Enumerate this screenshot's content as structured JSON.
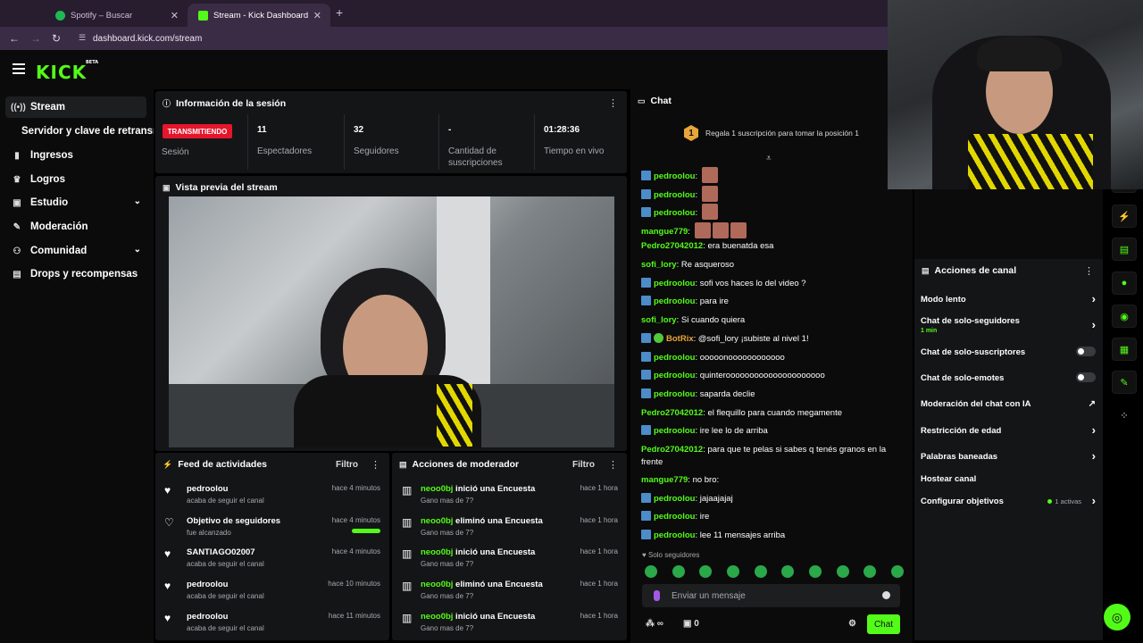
{
  "browser": {
    "tabs": [
      {
        "label": "Spotify – Buscar",
        "color": "#1db954"
      },
      {
        "label": "Stream - Kick Dashboard",
        "color": "#53fc18"
      }
    ],
    "url": "dashboard.kick.com/stream"
  },
  "brand": {
    "logo": "KICK",
    "beta": "BETA",
    "accent": "#53fc18"
  },
  "sidebar": {
    "items": [
      {
        "label": "Stream",
        "icon": "broadcast-icon"
      },
      {
        "label": "Servidor y clave de retransmisión"
      },
      {
        "label": "Ingresos",
        "icon": "chart-icon"
      },
      {
        "label": "Logros",
        "icon": "trophy-icon"
      },
      {
        "label": "Estudio",
        "icon": "studio-icon"
      },
      {
        "label": "Moderación",
        "icon": "wrench-icon"
      },
      {
        "label": "Comunidad",
        "icon": "community-icon"
      },
      {
        "label": "Drops y recompensas",
        "icon": "gift-icon"
      }
    ]
  },
  "session": {
    "title": "Información de la sesión",
    "live_badge": "TRANSMITIENDO",
    "session_label": "Sesión",
    "stats": [
      {
        "value": "11",
        "label": "Espectadores"
      },
      {
        "value": "32",
        "label": "Seguidores"
      },
      {
        "value": "-",
        "label": "Cantidad de suscripciones"
      },
      {
        "value": "01:28:36",
        "label": "Tiempo en vivo"
      }
    ]
  },
  "preview": {
    "title": "Vista previa del stream"
  },
  "feed": {
    "title": "Feed de actividades",
    "filter": "Filtro",
    "items": [
      {
        "name": "pedroolou",
        "sub": "acaba de seguir el canal",
        "time": "hace 4 minutos",
        "icon": "heart-icon"
      },
      {
        "name": "Objetivo de seguidores",
        "sub": "fue alcanzado",
        "time": "hace 4 minutos",
        "icon": "heart-outline-icon",
        "progress": 1.0
      },
      {
        "name": "SANTIAGO02007",
        "sub": "acaba de seguir el canal",
        "time": "hace 4 minutos",
        "icon": "heart-icon"
      },
      {
        "name": "pedroolou",
        "sub": "acaba de seguir el canal",
        "time": "hace 10 minutos",
        "icon": "heart-icon"
      },
      {
        "name": "pedroolou",
        "sub": "acaba de seguir el canal",
        "time": "hace 11 minutos",
        "icon": "heart-icon"
      }
    ]
  },
  "modactions": {
    "title": "Acciones de moderador",
    "filter": "Filtro",
    "items": [
      {
        "user": "neoo0bj",
        "action": " inició una Encuesta",
        "sub": "Gano mas de 7?",
        "time": "hace 1 hora"
      },
      {
        "user": "neoo0bj",
        "action": " eliminó una Encuesta",
        "sub": "Gano mas de 7?",
        "time": "hace 1 hora"
      },
      {
        "user": "neoo0bj",
        "action": " inició una Encuesta",
        "sub": "Gano mas de 7?",
        "time": "hace 1 hora"
      },
      {
        "user": "neoo0bj",
        "action": " eliminó una Encuesta",
        "sub": "Gano mas de 7?",
        "time": "hace 1 hora"
      },
      {
        "user": "neoo0bj",
        "action": " inició una Encuesta",
        "sub": "Gano mas de 7?",
        "time": "hace 1 hora"
      }
    ]
  },
  "chat": {
    "title": "Chat",
    "pinned_rank": "1",
    "pinned_text": "Regala 1 suscripción para tomar la posición 1",
    "messages": [
      {
        "user": "pedroolou",
        "text": "",
        "mod": true,
        "emotes": 1
      },
      {
        "user": "pedroolou",
        "text": "",
        "mod": true,
        "emotes": 1
      },
      {
        "user": "pedroolou",
        "text": "",
        "mod": true,
        "emotes": 1
      },
      {
        "user": "mangue779",
        "text": "",
        "mod": false,
        "emotes": 3
      },
      {
        "user": "Pedro27042012",
        "text": "era buenatda esa",
        "mod": false
      },
      {
        "user": "sofi_lory",
        "text": "Re asqueroso",
        "mod": false
      },
      {
        "user": "pedroolou",
        "text": "sofi vos haces lo del video ?",
        "mod": true
      },
      {
        "user": "pedroolou",
        "text": "para ire",
        "mod": true
      },
      {
        "user": "sofi_lory",
        "text": "Si cuando quiera",
        "mod": false
      },
      {
        "user": "BotRix",
        "text": "@sofi_lory ¡subiste al nivel 1!",
        "mod": true,
        "verified": true
      },
      {
        "user": "pedroolou",
        "text": "ooooonoooooooooooo",
        "mod": true
      },
      {
        "user": "pedroolou",
        "text": "quinterooooooooooooooooooooo",
        "mod": true
      },
      {
        "user": "pedroolou",
        "text": "saparda declie",
        "mod": true
      },
      {
        "user": "Pedro27042012",
        "text": "el flequillo para cuando megamente",
        "mod": false
      },
      {
        "user": "pedroolou",
        "text": "ire lee lo de arriba",
        "mod": true
      },
      {
        "user": "Pedro27042012",
        "text": "para que te pelas si sabes q tenés granos en la frente",
        "mod": false
      },
      {
        "user": "mangue779",
        "text": "no bro:",
        "mod": false
      },
      {
        "user": "pedroolou",
        "text": "jajaajajaj",
        "mod": true
      },
      {
        "user": "pedroolou",
        "text": "ire",
        "mod": true
      },
      {
        "user": "pedroolou",
        "text": "lee 11 mensajes arriba",
        "mod": true
      }
    ],
    "solo_label": "Solo seguidores",
    "input_placeholder": "Enviar un mensaje",
    "points": "∞",
    "gifts": "0",
    "send_label": "Chat"
  },
  "channel_actions": {
    "title": "Acciones de canal",
    "items": [
      {
        "label": "Modo lento",
        "kind": "arrow"
      },
      {
        "label": "Chat de solo-seguidores",
        "kind": "arrow",
        "sub": "1 min"
      },
      {
        "label": "Chat de solo-suscriptores",
        "kind": "toggle"
      },
      {
        "label": "Chat de solo-emotes",
        "kind": "toggle"
      },
      {
        "label": "Moderación del chat con IA",
        "kind": "link"
      },
      {
        "label": "Restricción de edad",
        "kind": "arrow"
      },
      {
        "label": "Palabras baneadas",
        "kind": "arrow"
      },
      {
        "label": "Hostear canal",
        "kind": "none"
      },
      {
        "label": "Configurar objetivos",
        "kind": "arrow",
        "info": "1 activas"
      }
    ]
  }
}
